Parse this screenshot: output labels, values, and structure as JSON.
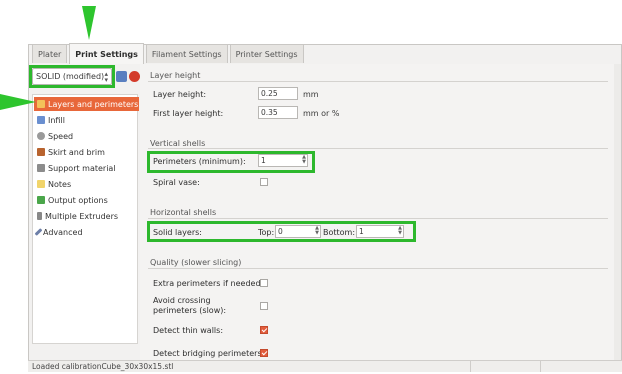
{
  "tabs": [
    "Plater",
    "Print Settings",
    "Filament Settings",
    "Printer Settings"
  ],
  "active_tab": "Print Settings",
  "preset": {
    "value": "SOLID (modified)"
  },
  "sidebar": {
    "items": [
      {
        "label": "Layers and perimeters",
        "icon": "layers-icon",
        "selected": true
      },
      {
        "label": "Infill",
        "icon": "infill-icon"
      },
      {
        "label": "Speed",
        "icon": "speed-icon"
      },
      {
        "label": "Skirt and brim",
        "icon": "skirt-icon"
      },
      {
        "label": "Support material",
        "icon": "support-icon"
      },
      {
        "label": "Notes",
        "icon": "notes-icon"
      },
      {
        "label": "Output options",
        "icon": "output-icon"
      },
      {
        "label": "Multiple Extruders",
        "icon": "extruders-icon"
      },
      {
        "label": "Advanced",
        "icon": "wrench-icon"
      }
    ]
  },
  "layer_height": {
    "section": "Layer height",
    "layer_height_label": "Layer height:",
    "layer_height_value": "0.25",
    "layer_height_unit": "mm",
    "first_layer_label": "First layer height:",
    "first_layer_value": "0.35",
    "first_layer_unit": "mm or %"
  },
  "vertical_shells": {
    "section": "Vertical shells",
    "perimeters_label": "Perimeters (minimum):",
    "perimeters_value": "1",
    "spiral_label": "Spiral vase:",
    "spiral_checked": false
  },
  "horizontal_shells": {
    "section": "Horizontal shells",
    "solid_label": "Solid layers:",
    "top_label": "Top:",
    "top_value": "0",
    "bottom_label": "Bottom:",
    "bottom_value": "1"
  },
  "quality": {
    "section": "Quality (slower slicing)",
    "extra_label": "Extra perimeters if needed:",
    "extra_checked": false,
    "avoid_label": "Avoid crossing perimeters (slow):",
    "avoid_checked": false,
    "thin_label": "Detect thin walls:",
    "thin_checked": true,
    "bridging_label": "Detect bridging perimeters:",
    "bridging_checked": true
  },
  "status": {
    "text": "Loaded calibrationCube_30x30x15.stl"
  },
  "colors": {
    "selected": "#e8673a",
    "highlight": "#2db82d",
    "checkbox_on": "#e25c3c"
  }
}
